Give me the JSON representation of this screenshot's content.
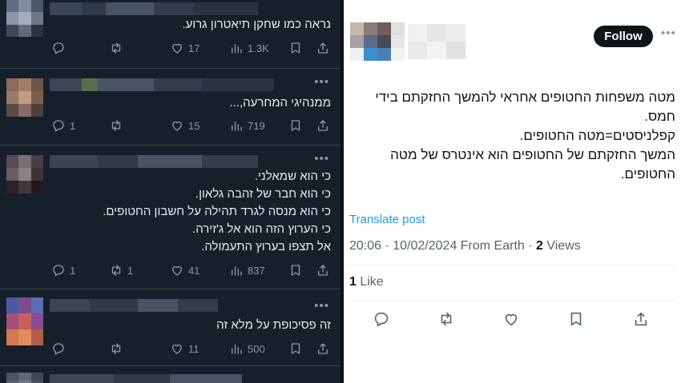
{
  "feed": {
    "tweets": [
      {
        "text": [
          "נראה כמו שחקן תיאטרון גרוע."
        ],
        "reply": "",
        "retweets": "",
        "likes": "17",
        "views": "1.3K"
      },
      {
        "text": [
          "ממנהיגי המחרעה,..."
        ],
        "reply": "1",
        "retweets": "",
        "likes": "15",
        "views": "719"
      },
      {
        "text": [
          "כי הוא שמאלני.",
          "כי הוא חבר של זהבה גלאון.",
          "כי הוא מנסה לגרד תהילה על חשבון החטופים.",
          "כי הערוץ הזה הוא אל ג'זירה.",
          "אל תצפו בערוץ התעמולה."
        ],
        "reply": "1",
        "retweets": "1",
        "likes": "41",
        "views": "837"
      },
      {
        "text": [
          "זה פסיכופת על מלא זה"
        ],
        "reply": "",
        "retweets": "",
        "likes": "11",
        "views": "500"
      }
    ]
  },
  "post": {
    "follow_label": "Follow",
    "body": [
      "מטה משפחות החטופים אחראי להמשך החזקתם בידי",
      "חמס.",
      "קפלניסטים=מטה החטופים.",
      "המשך החזקתם של החטופים הוא אינטרס של מטה",
      "החטופים."
    ],
    "translate_label": "Translate post",
    "meta_text": "20:06 · 10/02/2024 From Earth · ",
    "views_count": "2",
    "views_label": " Views",
    "likes_count": "1",
    "likes_label": " Like"
  },
  "icons": [
    "reply-icon",
    "retweet-icon",
    "like-icon",
    "views-icon",
    "bookmark-icon",
    "share-icon"
  ],
  "colors": {
    "dark_bg": "#15202b",
    "dark_text": "#e7e9ea",
    "muted": "#8b98a5",
    "link": "#1d9bf0",
    "follow_bg": "#0f1419"
  }
}
